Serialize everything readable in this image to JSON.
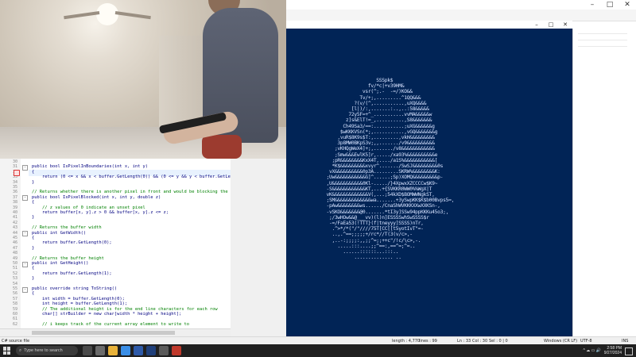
{
  "editor": {
    "lines": [
      {
        "num": "30",
        "text": "",
        "type": "plain"
      },
      {
        "num": "31",
        "text": "public bool IsPixelInBoundaries(int x, int y)",
        "type": "plain"
      },
      {
        "num": "32",
        "text": "{",
        "type": "plain"
      },
      {
        "num": "33",
        "text": "    return (0 <= x && x < buffer.GetLength(0)) && (0 <= y && y < buffer.GetLe",
        "type": "plain"
      },
      {
        "num": "34",
        "text": "}",
        "type": "plain"
      },
      {
        "num": "35",
        "text": "",
        "type": "plain"
      },
      {
        "num": "36",
        "text": "// Returns whether there is another pixel in front and would be blocking the",
        "type": "comment"
      },
      {
        "num": "37",
        "text": "public bool IsPixelBlocked(int x, int y, double z)",
        "type": "plain"
      },
      {
        "num": "38",
        "text": "{",
        "type": "plain"
      },
      {
        "num": "39",
        "text": "    // z values of 0 indicate an unset pixel",
        "type": "comment"
      },
      {
        "num": "40",
        "text": "    return buffer[x, y].z > 0 && buffer[x, y].z <= z;",
        "type": "plain"
      },
      {
        "num": "41",
        "text": "}",
        "type": "plain"
      },
      {
        "num": "42",
        "text": "",
        "type": "plain"
      },
      {
        "num": "43",
        "text": "// Returns the buffer width",
        "type": "comment"
      },
      {
        "num": "44",
        "text": "public int GetWidth()",
        "type": "plain"
      },
      {
        "num": "45",
        "text": "{",
        "type": "plain"
      },
      {
        "num": "46",
        "text": "    return buffer.GetLength(0);",
        "type": "plain"
      },
      {
        "num": "47",
        "text": "}",
        "type": "plain"
      },
      {
        "num": "48",
        "text": "",
        "type": "plain"
      },
      {
        "num": "49",
        "text": "// Returns the buffer height",
        "type": "comment"
      },
      {
        "num": "50",
        "text": "public int GetHeight()",
        "type": "plain"
      },
      {
        "num": "51",
        "text": "{",
        "type": "plain"
      },
      {
        "num": "52",
        "text": "    return buffer.GetLength(1);",
        "type": "plain"
      },
      {
        "num": "53",
        "text": "}",
        "type": "plain"
      },
      {
        "num": "54",
        "text": "",
        "type": "plain"
      },
      {
        "num": "55",
        "text": "public override string ToString()",
        "type": "plain"
      },
      {
        "num": "56",
        "text": "{",
        "type": "plain"
      },
      {
        "num": "57",
        "text": "    int width = buffer.GetLength(0);",
        "type": "plain"
      },
      {
        "num": "58",
        "text": "    int height = buffer.GetLength(1);",
        "type": "plain"
      },
      {
        "num": "59",
        "text": "    // The additional height is for the end line characters for each row",
        "type": "comment"
      },
      {
        "num": "60",
        "text": "    char[] strBuilder = new char[width * height + height];",
        "type": "plain"
      },
      {
        "num": "61",
        "text": "",
        "type": "plain"
      },
      {
        "num": "62",
        "text": "    // i keeps track of the current array element to write to",
        "type": "comment"
      }
    ]
  },
  "statusbar": {
    "file_type": "C# source file",
    "length": "length : 4,770",
    "lines": "lines : 99",
    "ln": "Ln : 33",
    "col": "Col : 30",
    "sel": "Sel : 0 | 0",
    "eol": "Windows (CR LF)",
    "encoding": "UTF-8",
    "mode": "INS"
  },
  "powershell": {
    "title_buttons": [
      "–",
      "□",
      "✕"
    ],
    "ascii_lines": [
      "                     SSSpk$",
      "                  fv/*c|+v39HM&",
      "                vsr(^;.-  -=/)KO&&",
      "               Tv/+;,.........^1QQ&&&",
      "             ?(v/(^,...........,uXQ&&&&",
      "            [l|)/:,.......:..,..:58&&&&&",
      "           72y5F=+^_...........vvMA&&&&&w",
      "          z]s&ElT!=_,..........,S8&&&&&&&",
      "         Ch49Sa3/==:...........;uXG&&&&&&g",
      "        $wKKKVSn(*;,...........,vGQ&&&&&&&g",
      "       ,vuR$8K9s$T:,.........,vkH&&&&&&&&&",
      "       3p8MW0BKpS3v;,,......./v9&&&&&&&&&&",
      "      ;vKHQgWeX4]+;,......./v8&&&&&&&&&&&&",
      "      ;Smw&&&EwlK5]r,...../xa93%&&&&&&&&&&e",
      "     ;pR&&&&&&&&KxX4T,..../a1S%&&&&&&&&&&&[",
      "     *K$&&&&&&&&&xvyr^......./SwSJ&&&&&&&&&0s",
      "    vX&&&&&&&&&&0p3A.........SKRW%&&&&&&&&K:",
      "   ;Uw&&&&&&&&&&&G]^......;Sp)XOMQ&&&&&&&&&p-",
      "   ,U&&&&&&&&&&&0Kl-...../}4XpwxXZCCCCw$K9~",
      "   -S&&&&&&&&&&&&KT,...+{SVKKR0WW0%%WgX|T",
      "   vK&&&&&&&&&&&&&V(,...;54kXD$BOMWWNgkST,",
      "   ;SM&&&&&&&&&&&&&wa.......+3ySwpKK$K$b00Bvps5=,",
      "   -pAw&&&&&&&&ws....../CnaShWVKKKXXwXXKSn-,",
      "   -vSKO&&&&&&&@0.......*tI3y]SSw94ppKKKu45o3;,",
      "    ;/3wHOw&&@___vv)(l)n]ESSSSwhSwSSSS$r",
      "    -=/FaEa53(!TTT}(f|tneyyy]SSSS)nTr,",
      "     .^>*/*(\"/\"////75T[CC[[t5yotIvT\"=-",
      "     ..,.^==;;;;;+/rc*//T(3(v/c>,-",
      "     ,..-:;;;;:,,;;^=;;++c\"/!c/\\c>,-.",
      "       .....:::....;;^==:,==^=;^=..",
      "         ......::::::...:::..",
      "             .............. .."
    ]
  },
  "taskbar": {
    "search_placeholder": "Type here to search",
    "tray_icons": "^  ☁  ▭  🔊",
    "time": "2:58 PM",
    "date": "9/27/2024"
  },
  "colors": {
    "powershell_bg": "#012456",
    "taskbar_bg": "#202020",
    "comment": "#008000",
    "keyword": "#0000ff"
  }
}
